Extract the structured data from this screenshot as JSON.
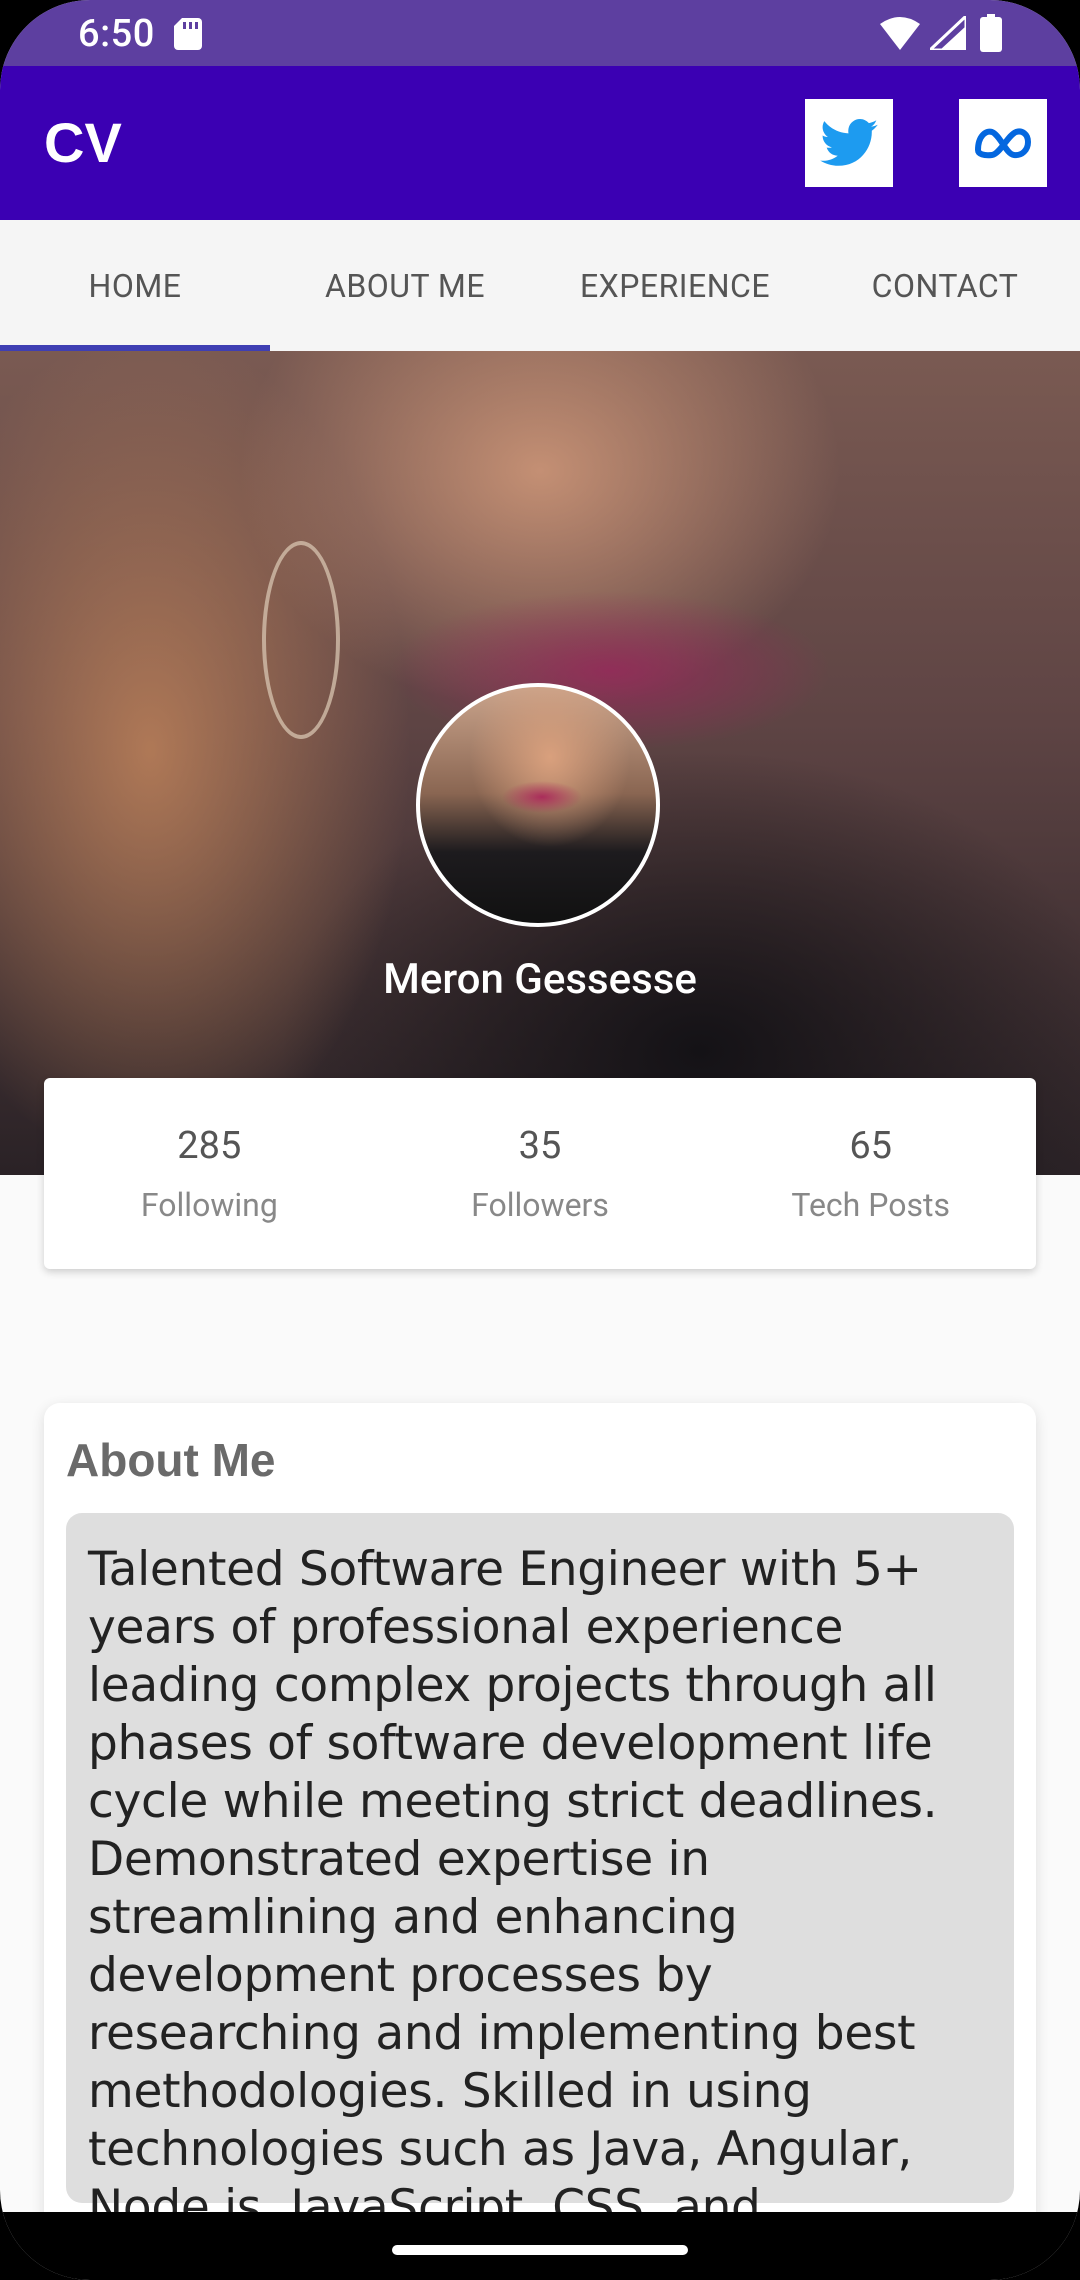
{
  "status_bar": {
    "time": "6:50",
    "icons": [
      "sd-card-icon",
      "wifi-icon",
      "signal-icon",
      "battery-icon"
    ]
  },
  "app_bar": {
    "title": "CV",
    "actions": [
      "twitter-icon",
      "meta-icon"
    ],
    "background_color": "#3b00b3"
  },
  "tabs": [
    {
      "label": "HOME",
      "active": true
    },
    {
      "label": "ABOUT ME",
      "active": false
    },
    {
      "label": "EXPERIENCE",
      "active": false
    },
    {
      "label": "CONTACT",
      "active": false
    }
  ],
  "profile": {
    "name": "Meron Gessesse"
  },
  "stats": [
    {
      "value": "285",
      "label": "Following"
    },
    {
      "value": "35",
      "label": "Followers"
    },
    {
      "value": "65",
      "label": "Tech Posts"
    }
  ],
  "about": {
    "title": "About Me",
    "text": "Talented Software Engineer with 5+ years of professional experience leading complex projects through all phases of software development life cycle while meeting strict deadlines. Demonstrated expertise in streamlining and enhancing development processes by researching and implementing best methodologies. Skilled in using technologies such as Java, Angular, Node.js, JavaScript, CSS, and Hibernate."
  },
  "colors": {
    "accent": "#3f3fb3",
    "twitter": "#1d9bf0",
    "meta": "#0467df"
  }
}
